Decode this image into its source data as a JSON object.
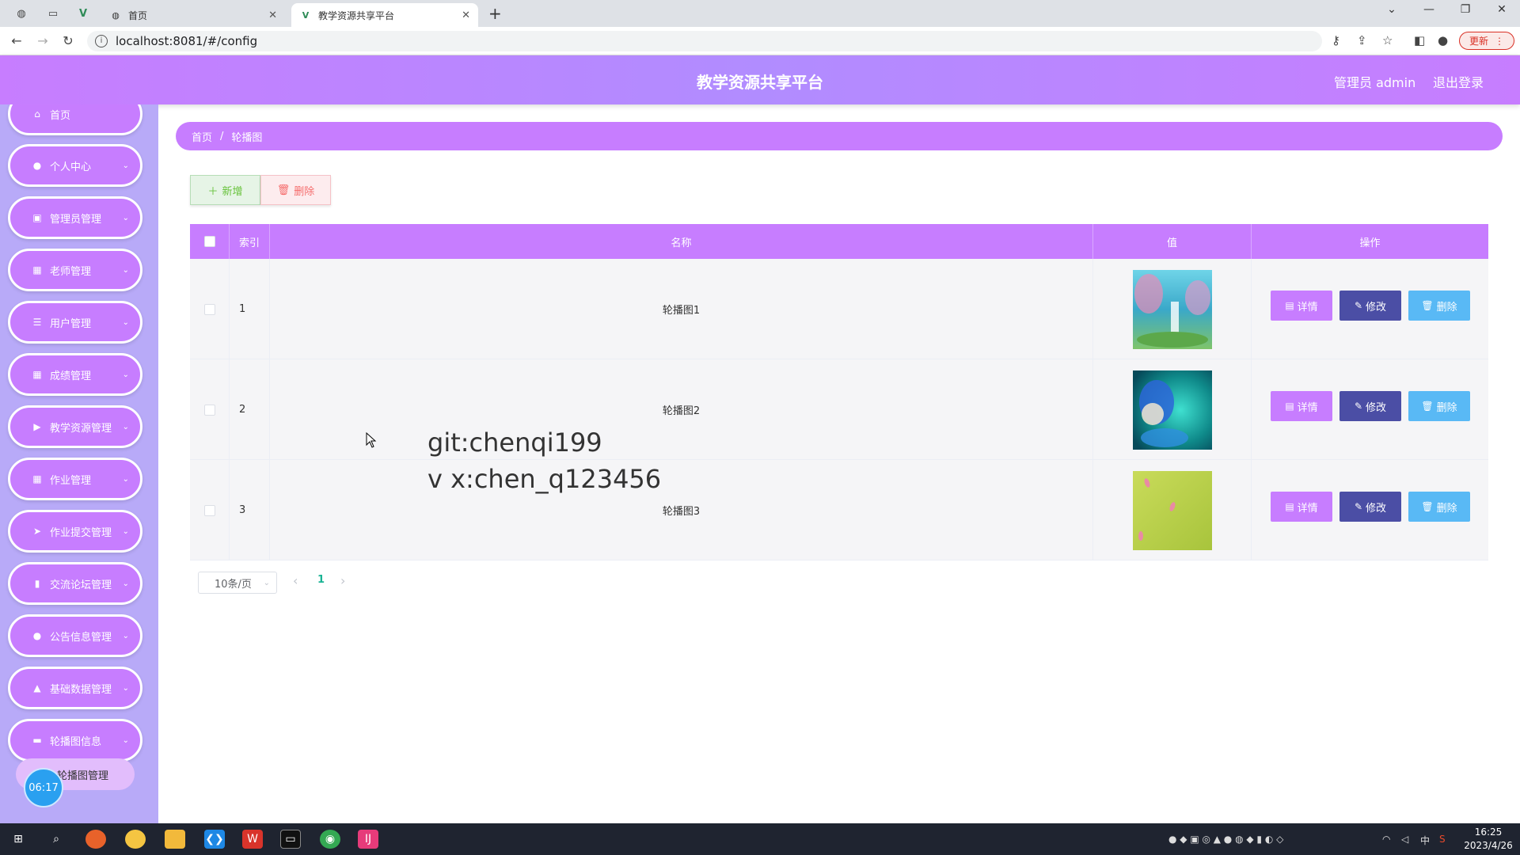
{
  "browser": {
    "tabs": [
      {
        "label": "首页",
        "active": false
      },
      {
        "label": "教学资源共享平台",
        "active": true
      }
    ],
    "url": "localhost:8081/#/config",
    "update_label": "更新"
  },
  "header": {
    "title": "教学资源共享平台",
    "user_label": "管理员 admin",
    "logout_label": "退出登录"
  },
  "sidebar": {
    "items": [
      {
        "label": "首页",
        "icon": "home-icon"
      },
      {
        "label": "个人中心",
        "icon": "user-icon"
      },
      {
        "label": "管理员管理",
        "icon": "clipboard-icon"
      },
      {
        "label": "老师管理",
        "icon": "grid-icon"
      },
      {
        "label": "用户管理",
        "icon": "list-icon"
      },
      {
        "label": "成绩管理",
        "icon": "grid-icon"
      },
      {
        "label": "教学资源管理",
        "icon": "video-icon"
      },
      {
        "label": "作业管理",
        "icon": "grid-icon"
      },
      {
        "label": "作业提交管理",
        "icon": "send-icon"
      },
      {
        "label": "交流论坛管理",
        "icon": "bar-chart-icon"
      },
      {
        "label": "公告信息管理",
        "icon": "location-icon"
      },
      {
        "label": "基础数据管理",
        "icon": "thumb-up-icon"
      },
      {
        "label": "轮播图信息",
        "icon": "suitcase-icon"
      }
    ],
    "submenu_label": "轮播图管理",
    "timer": "06:17"
  },
  "breadcrumb": {
    "home": "首页",
    "separator": "/",
    "current": "轮播图"
  },
  "toolbar": {
    "add_label": "新增",
    "delete_label": "删除"
  },
  "table": {
    "columns": {
      "index": "索引",
      "name": "名称",
      "value": "值",
      "actions": "操作"
    },
    "rows": [
      {
        "index": "1",
        "name": "轮播图1"
      },
      {
        "index": "2",
        "name": "轮播图2"
      },
      {
        "index": "3",
        "name": "轮播图3"
      }
    ],
    "action_labels": {
      "detail": "详情",
      "edit": "修改",
      "delete": "删除"
    }
  },
  "pagination": {
    "page_size": "10条/页",
    "current_page": "1"
  },
  "watermark": {
    "line1": "git:chenqi199",
    "line2": "v x:chen_q123456"
  },
  "taskbar": {
    "time": "16:25",
    "date": "2023/4/26",
    "ime": "中"
  },
  "colors": {
    "accent": "#c77dff",
    "sidebar_bg": "#b8aaf8",
    "edit_button": "#4b4ea5",
    "delete_button": "#59b9f5"
  }
}
